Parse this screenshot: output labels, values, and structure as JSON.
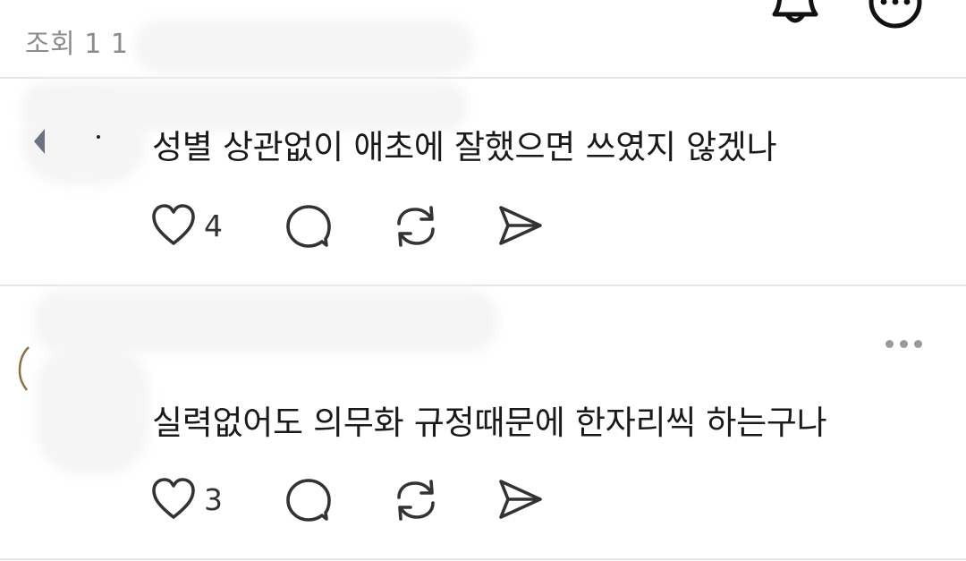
{
  "header": {
    "views_label": "조회 1 1",
    "icons": [
      "bell-icon",
      "more-icon"
    ]
  },
  "comments": [
    {
      "text": "성별 상관없이 애초에 잘했으면 쓰였지 않겠나",
      "like_count": "4",
      "actions": [
        "heart-icon",
        "comment-icon",
        "repost-icon",
        "send-icon"
      ]
    },
    {
      "text": "실력없어도 의무화 규정때문에 한자리씩 하는구나",
      "like_count": "3",
      "actions": [
        "heart-icon",
        "comment-icon",
        "repost-icon",
        "send-icon"
      ]
    }
  ],
  "colors": {
    "background": "#ffffff",
    "divider": "#e6e6e6",
    "text": "#1a1a1a",
    "muted": "#8c8c8c",
    "icon": "#333333"
  }
}
